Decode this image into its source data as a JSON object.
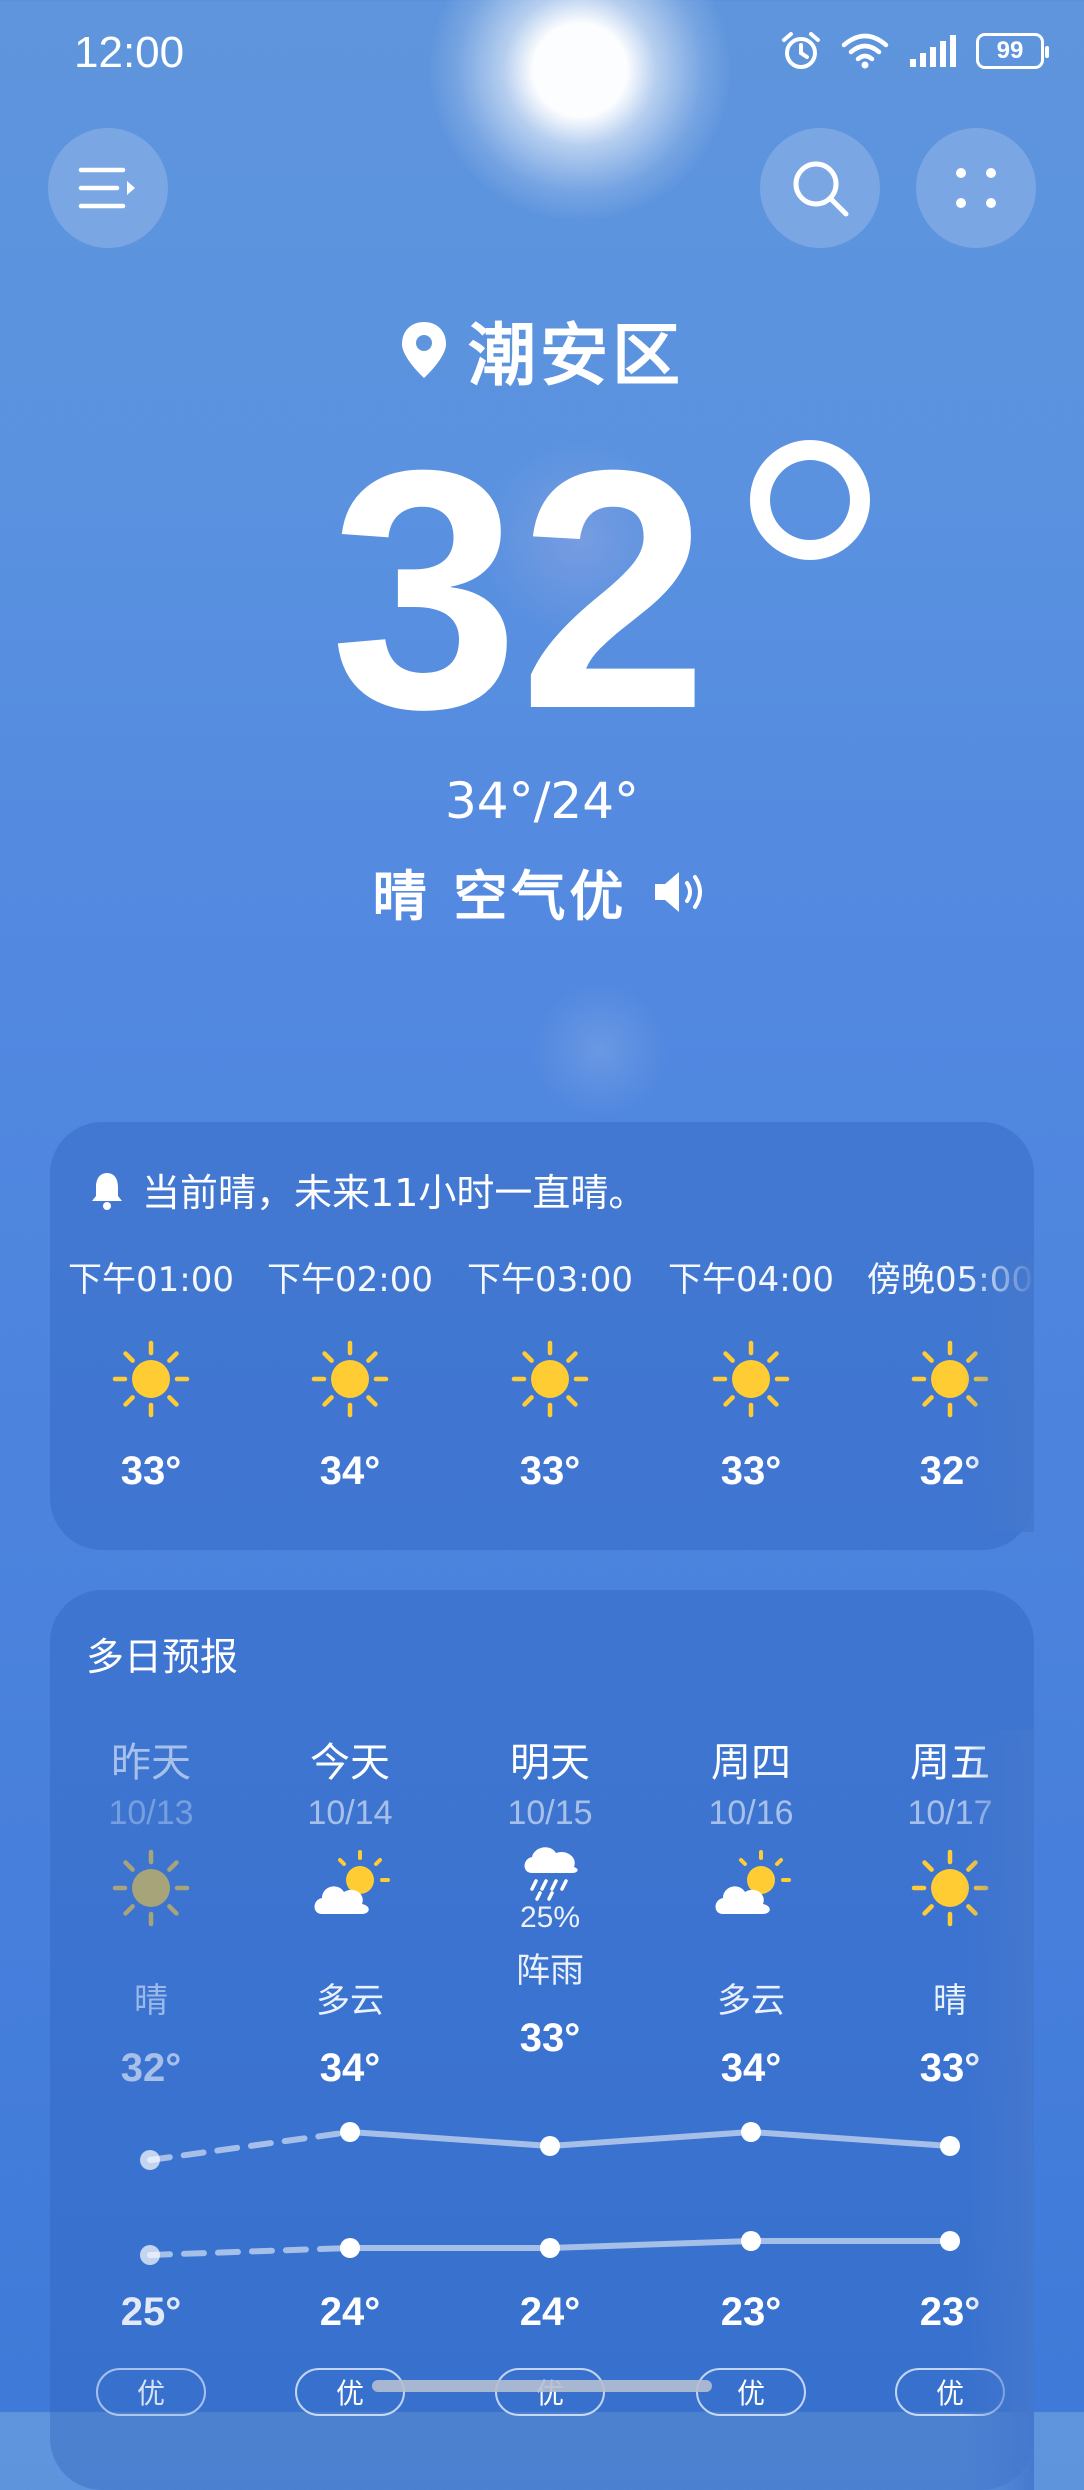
{
  "status_bar": {
    "time": "12:00",
    "battery": "99"
  },
  "location": {
    "name": "潮安区"
  },
  "current": {
    "temperature": "32",
    "range": "34°/24°",
    "condition": "晴 空气优"
  },
  "hourly": {
    "alert": "当前晴，未来11小时一直晴。",
    "items": [
      {
        "time": "下午01:00",
        "temp": "33°",
        "icon": "sun-icon"
      },
      {
        "time": "下午02:00",
        "temp": "34°",
        "icon": "sun-icon"
      },
      {
        "time": "下午03:00",
        "temp": "33°",
        "icon": "sun-icon"
      },
      {
        "time": "下午04:00",
        "temp": "33°",
        "icon": "sun-icon"
      },
      {
        "time": "傍晚05:00",
        "temp": "32°",
        "icon": "sun-icon"
      }
    ]
  },
  "forecast": {
    "title": "多日预报",
    "days": [
      {
        "name": "昨天",
        "date": "10/13",
        "icon": "sun-icon",
        "precip": "",
        "condition": "晴",
        "high": "32°",
        "low": "25°",
        "aqi": "优",
        "high_value": 32,
        "low_value": 25
      },
      {
        "name": "今天",
        "date": "10/14",
        "icon": "partly-cloudy-icon",
        "precip": "",
        "condition": "多云",
        "high": "34°",
        "low": "24°",
        "aqi": "优",
        "high_value": 34,
        "low_value": 24
      },
      {
        "name": "明天",
        "date": "10/15",
        "icon": "rain-icon",
        "precip": "25%",
        "condition": "阵雨",
        "high": "33°",
        "low": "24°",
        "aqi": "优",
        "high_value": 33,
        "low_value": 24
      },
      {
        "name": "周四",
        "date": "10/16",
        "icon": "partly-cloudy-icon",
        "precip": "",
        "condition": "多云",
        "high": "34°",
        "low": "23°",
        "aqi": "优",
        "high_value": 34,
        "low_value": 23
      },
      {
        "name": "周五",
        "date": "10/17",
        "icon": "sun-icon",
        "precip": "",
        "condition": "晴",
        "high": "33°",
        "low": "23°",
        "aqi": "优",
        "high_value": 33,
        "low_value": 23
      }
    ]
  },
  "colors": {
    "sun": "#FFCC33",
    "background": "#4C84DD"
  }
}
